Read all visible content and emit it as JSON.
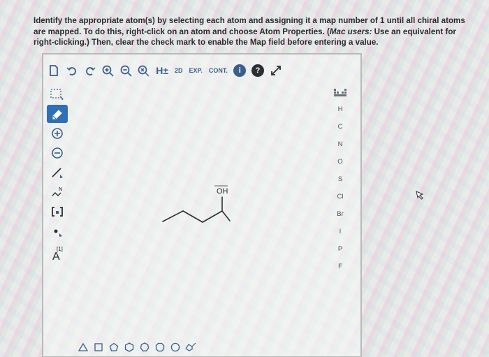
{
  "instructions": {
    "part1": "Identify the appropriate atom(s) by selecting each atom and assigning it a map number of 1 until all chiral atoms are mapped. To do this, right-click on an atom and choose Atom Properties. (",
    "mac_note": "Mac users:",
    "part2": " Use an equivalent for right-clicking.) Then, clear the check mark to enable the Map field before entering a value."
  },
  "toolbar": {
    "h_label": "H±",
    "twod_label": "2D",
    "exp_label": "EXP.",
    "cont_label": "CONT.",
    "info_label": "i",
    "help_label": "?"
  },
  "left_tools": {
    "map_label": "[1]",
    "atom_label": "A"
  },
  "elements": [
    "H",
    "C",
    "N",
    "O",
    "S",
    "Cl",
    "Br",
    "I",
    "P",
    "F"
  ],
  "molecule": {
    "label": "OH"
  },
  "colors": {
    "accent": "#3a5f8a",
    "active": "#2f6fb5"
  }
}
